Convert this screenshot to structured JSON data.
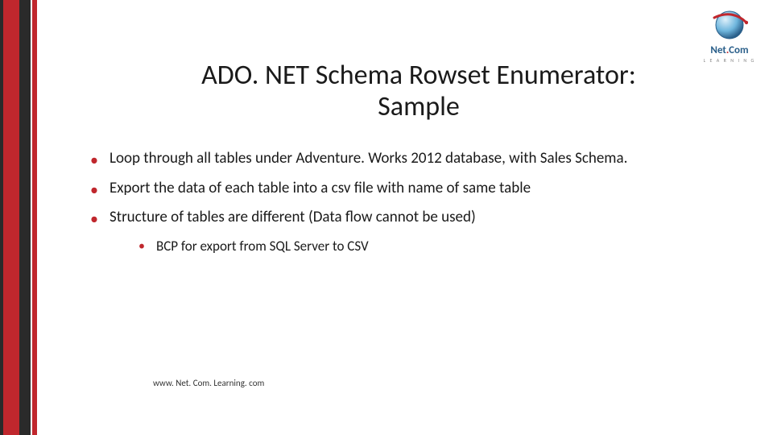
{
  "title_line1": "ADO. NET Schema Rowset Enumerator:",
  "title_line2": "Sample",
  "bullets": [
    "Loop through all tables under Adventure. Works 2012 database, with Sales Schema.",
    "Export the data of each table into a csv file with name of same table",
    "Structure of tables are different (Data flow cannot be used)"
  ],
  "sub_bullets": [
    "BCP for export from SQL Server to CSV"
  ],
  "footer": "www. Net. Com. Learning. com",
  "logo": {
    "name_part1": "Net",
    "name_part2": "Com",
    "sub": "L E A R N I N G"
  },
  "colors": {
    "accent_red": "#c0272d",
    "dark": "#2a2a2a",
    "logo_blue": "#2a5f8a"
  }
}
